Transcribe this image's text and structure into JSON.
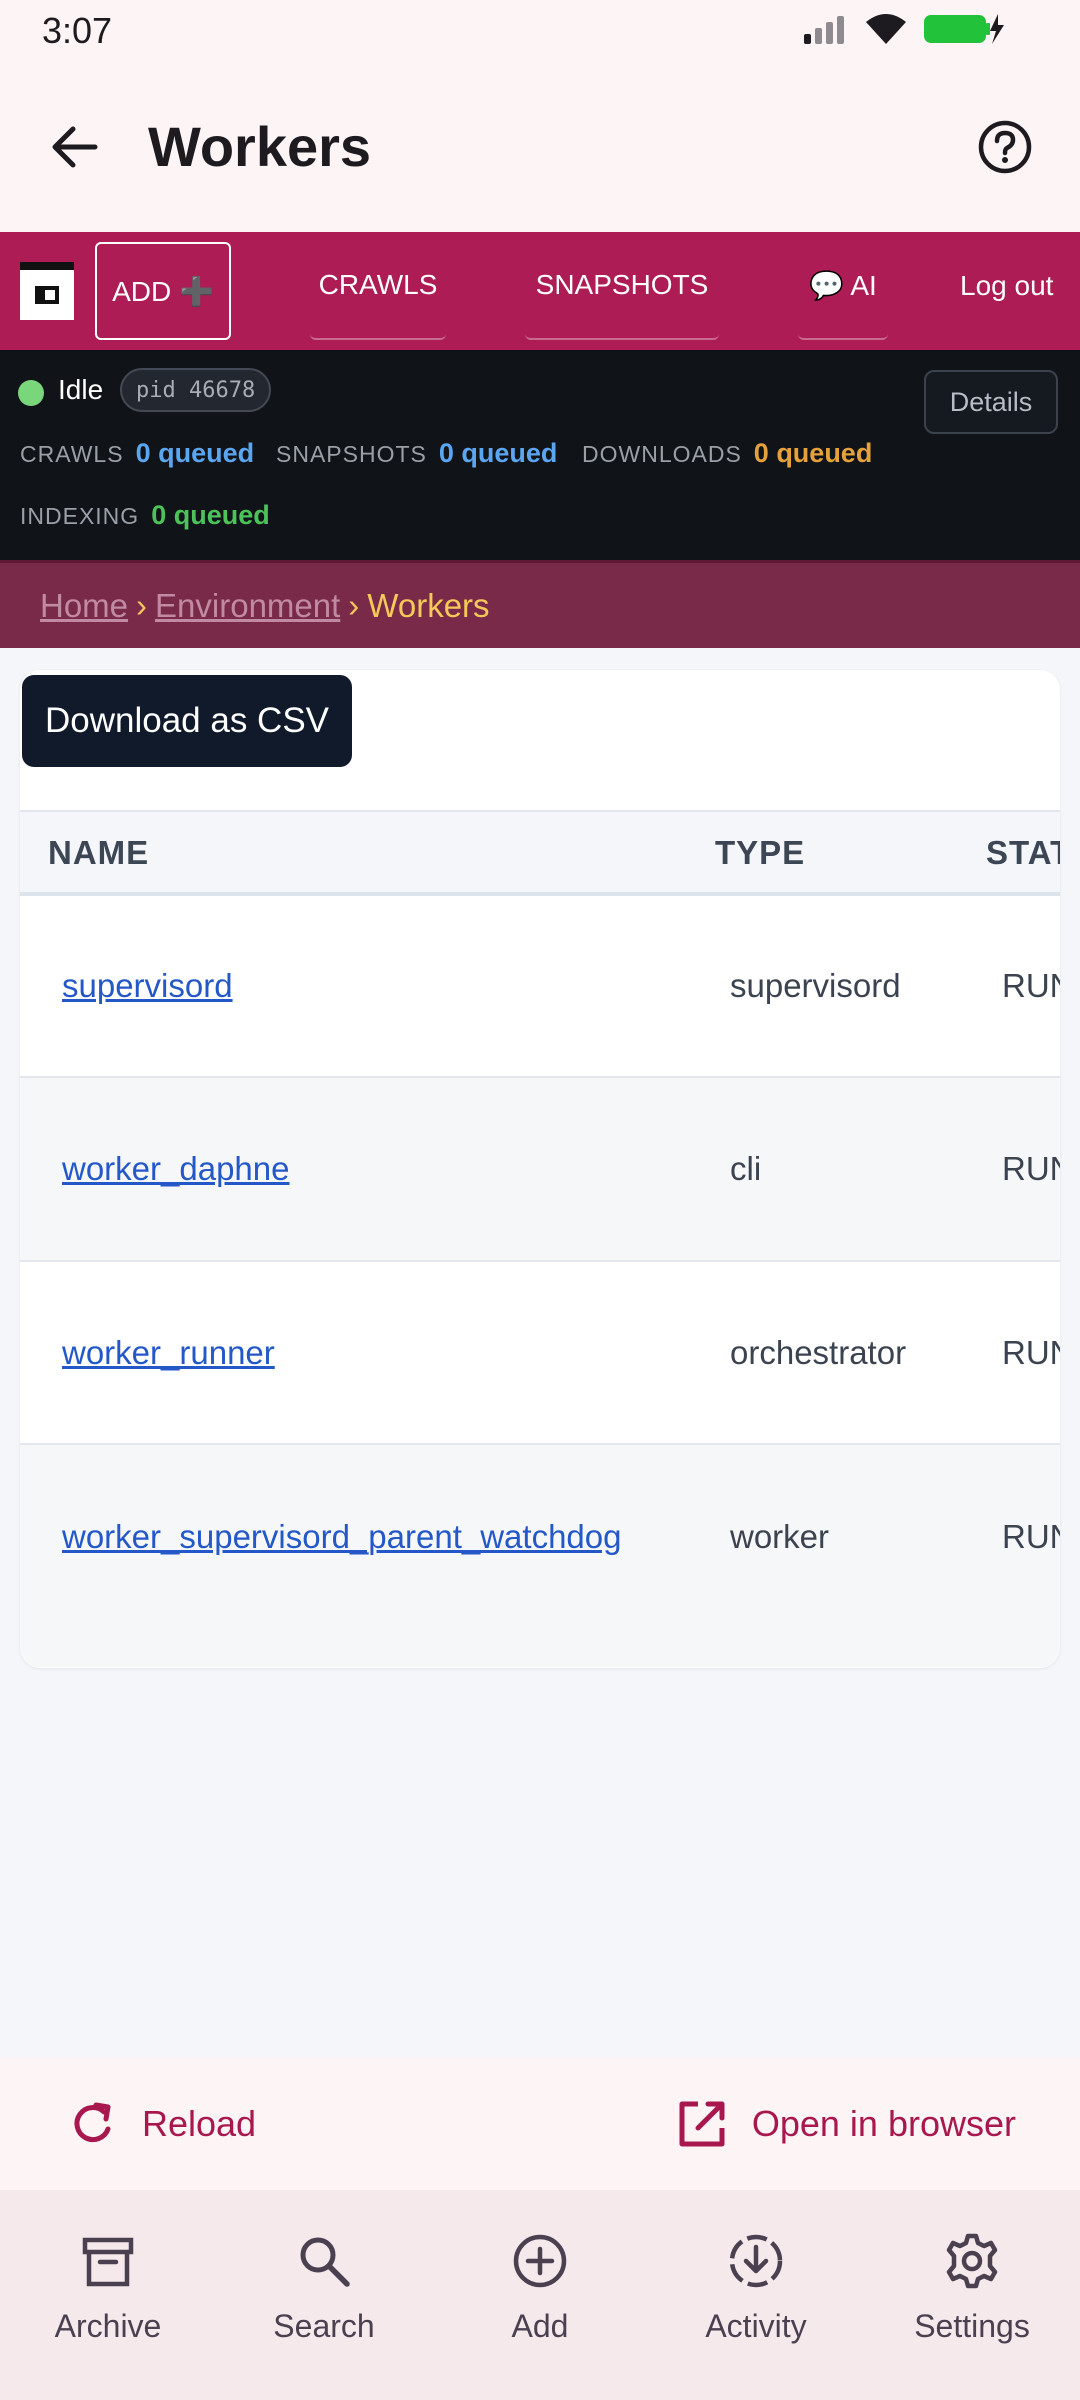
{
  "status_bar": {
    "time": "3:07"
  },
  "app_bar": {
    "title": "Workers"
  },
  "web_nav": {
    "add_label": "ADD ➕",
    "crawls_label": "CRAWLS",
    "snapshots_label": "SNAPSHOTS",
    "ai_label": "💬 AI",
    "logout_label": "Log out"
  },
  "status_panel": {
    "state": "Idle",
    "pid": "pid 46678",
    "details_label": "Details",
    "queues": [
      {
        "label": "CRAWLS",
        "value": "0 queued"
      },
      {
        "label": "SNAPSHOTS",
        "value": "0 queued"
      },
      {
        "label": "DOWNLOADS",
        "value": "0 queued"
      },
      {
        "label": "INDEXING",
        "value": "0 queued"
      }
    ]
  },
  "breadcrumb": {
    "items": [
      "Home",
      "Environment",
      "Workers"
    ],
    "separator": "›"
  },
  "card": {
    "csv_label": "Download as CSV",
    "columns": [
      "NAME",
      "TYPE",
      "STAT"
    ],
    "rows": [
      {
        "name": "supervisord",
        "type": "supervisord",
        "status": "RUN"
      },
      {
        "name": "worker_daphne",
        "type": "cli",
        "status": "RUN"
      },
      {
        "name": "worker_runner",
        "type": "orchestrator",
        "status": "RUN"
      },
      {
        "name": "worker_supervisord_parent_watchdog",
        "type": "worker",
        "status": "RUN"
      }
    ]
  },
  "actions": {
    "reload_label": "Reload",
    "open_label": "Open in browser"
  },
  "bottom_nav": {
    "items": [
      {
        "label": "Archive",
        "icon": "archive-icon"
      },
      {
        "label": "Search",
        "icon": "search-icon"
      },
      {
        "label": "Add",
        "icon": "add-circle-icon"
      },
      {
        "label": "Activity",
        "icon": "activity-download-icon"
      },
      {
        "label": "Settings",
        "icon": "gear-icon"
      }
    ]
  },
  "colors": {
    "brand": "#ad1c54",
    "accent_text": "#a8184e",
    "link": "#2458c9",
    "status_dark": "#101318",
    "breadcrumb_bg": "#7a2a49"
  }
}
